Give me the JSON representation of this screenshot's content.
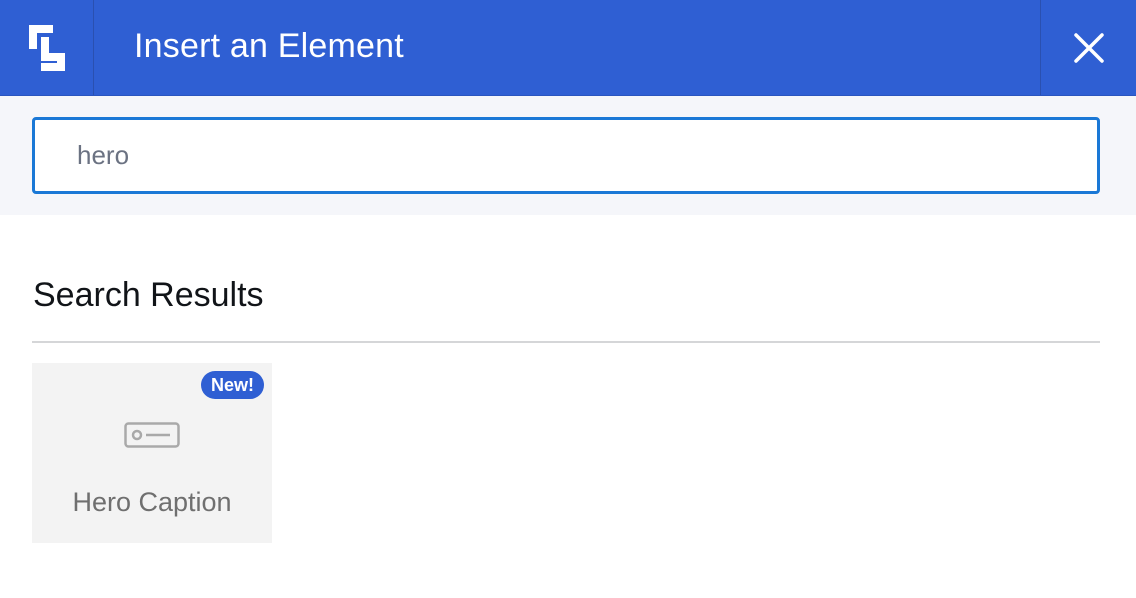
{
  "header": {
    "title": "Insert an Element",
    "logo_icon": "bracket-logo-icon",
    "close_icon": "close-icon",
    "accent_color": "#2f5fd3"
  },
  "search": {
    "value": "hero",
    "border_color": "#1a78d6"
  },
  "results": {
    "heading": "Search Results",
    "items": [
      {
        "label": "Hero Caption",
        "badge": "New!",
        "icon": "caption-card-icon"
      }
    ]
  }
}
